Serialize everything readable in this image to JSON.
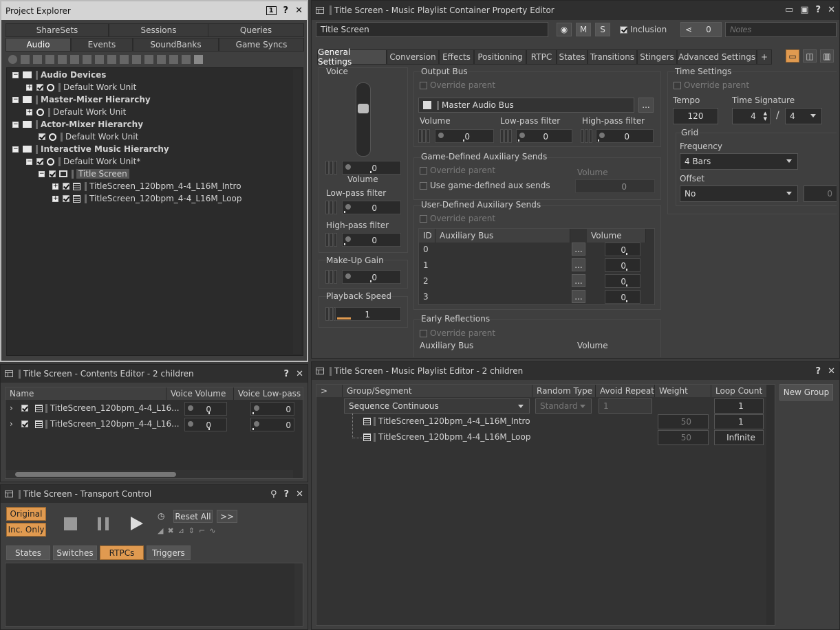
{
  "project_explorer": {
    "title": "Project Explorer",
    "badge": "1",
    "tabs_top": [
      "ShareSets",
      "Sessions",
      "Queries"
    ],
    "tabs_bottom": [
      "Audio",
      "Events",
      "SoundBanks",
      "Game Syncs"
    ],
    "tree": [
      {
        "label": "Audio Devices",
        "level": 0,
        "kind": "folder",
        "bold": true
      },
      {
        "label": "Default Work Unit",
        "level": 1,
        "kind": "wu"
      },
      {
        "label": "Master-Mixer Hierarchy",
        "level": 0,
        "kind": "folder",
        "bold": true
      },
      {
        "label": "Default Work Unit",
        "level": 1,
        "kind": "wu"
      },
      {
        "label": "Actor-Mixer Hierarchy",
        "level": 0,
        "kind": "folder",
        "bold": true
      },
      {
        "label": "Default Work Unit",
        "level": 1,
        "kind": "wu"
      },
      {
        "label": "Interactive Music Hierarchy",
        "level": 0,
        "kind": "folder",
        "bold": true
      },
      {
        "label": "Default Work Unit*",
        "level": 1,
        "kind": "wu"
      },
      {
        "label": "Title Screen",
        "level": 2,
        "kind": "playlist",
        "selected": true
      },
      {
        "label": "TitleScreen_120bpm_4-4_L16M_Intro",
        "level": 3,
        "kind": "segment"
      },
      {
        "label": "TitleScreen_120bpm_4-4_L16M_Loop",
        "level": 3,
        "kind": "segment"
      }
    ]
  },
  "property_editor": {
    "title": "Title Screen - Music Playlist Container Property Editor",
    "name": "Title Screen",
    "m_label": "M",
    "s_label": "S",
    "inclusion_label": "Inclusion",
    "share_count": "0",
    "notes_placeholder": "Notes",
    "tabs": [
      "General Settings",
      "Conversion",
      "Effects",
      "Positioning",
      "RTPC",
      "States",
      "Transitions",
      "Stingers",
      "Advanced Settings",
      "+"
    ],
    "voice": {
      "title": "Voice",
      "volume_label": "Volume",
      "volume": "0",
      "lpf_label": "Low-pass filter",
      "lpf": "0",
      "hpf_label": "High-pass filter",
      "hpf": "0"
    },
    "makeup": {
      "title": "Make-Up Gain",
      "value": "0"
    },
    "speed": {
      "title": "Playback Speed",
      "value": "1"
    },
    "output_bus": {
      "title": "Output Bus",
      "override": "Override parent",
      "bus": "Master Audio Bus",
      "browse": "...",
      "volume_label": "Volume",
      "volume": "0",
      "lpf_label": "Low-pass filter",
      "lpf": "0",
      "hpf_label": "High-pass filter",
      "hpf": "0"
    },
    "game_aux": {
      "title": "Game-Defined Auxiliary Sends",
      "override": "Override parent",
      "use": "Use game-defined aux sends",
      "volume_label": "Volume",
      "volume": "0"
    },
    "user_aux": {
      "title": "User-Defined Auxiliary Sends",
      "override": "Override parent",
      "headers": [
        "ID",
        "Auxiliary Bus",
        "Volume"
      ],
      "rows": [
        {
          "id": "0",
          "vol": "0"
        },
        {
          "id": "1",
          "vol": "0"
        },
        {
          "id": "2",
          "vol": "0"
        },
        {
          "id": "3",
          "vol": "0"
        }
      ],
      "browse": "..."
    },
    "early": {
      "title": "Early Reflections",
      "override": "Override parent",
      "bus_label": "Auxiliary Bus",
      "volume_label": "Volume"
    },
    "time": {
      "title": "Time Settings",
      "override": "Override parent",
      "tempo_label": "Tempo",
      "tempo": "120",
      "sig_label": "Time Signature",
      "sig_num": "4",
      "sig_sep": "/",
      "sig_den": "4",
      "grid_title": "Grid",
      "freq_label": "Frequency",
      "freq": "4 Bars",
      "offset_label": "Offset",
      "offset": "No",
      "offset_val": "0"
    }
  },
  "contents_editor": {
    "title": "Title Screen - Contents Editor - 2 children",
    "headers": [
      "Name",
      "Voice Volume",
      "Voice Low-pass f"
    ],
    "rows": [
      {
        "name": "TitleScreen_120bpm_4-4_L16...",
        "vol": "0",
        "lpf": "0"
      },
      {
        "name": "TitleScreen_120bpm_4-4_L16...",
        "vol": "0",
        "lpf": "0"
      }
    ]
  },
  "transport": {
    "title": "Title Screen - Transport Control",
    "original": "Original",
    "inc_only": "Inc. Only",
    "reset": "Reset All",
    "more": ">>",
    "tabs": [
      "States",
      "Switches",
      "RTPCs",
      "Triggers"
    ]
  },
  "playlist_editor": {
    "title": "Title Screen - Music Playlist Editor - 2 children",
    "headers": [
      ">",
      "Group/Segment",
      "Random Type",
      "Avoid Repeat",
      "Weight",
      "Loop Count"
    ],
    "group": {
      "name": "Sequence Continuous",
      "random": "Standard",
      "avoid": "1",
      "loop": "1"
    },
    "rows": [
      {
        "name": "TitleScreen_120bpm_4-4_L16M_Intro",
        "weight": "50",
        "loop": "1"
      },
      {
        "name": "TitleScreen_120bpm_4-4_L16M_Loop",
        "weight": "50",
        "loop": "Infinite"
      }
    ],
    "new_group": "New Group"
  }
}
